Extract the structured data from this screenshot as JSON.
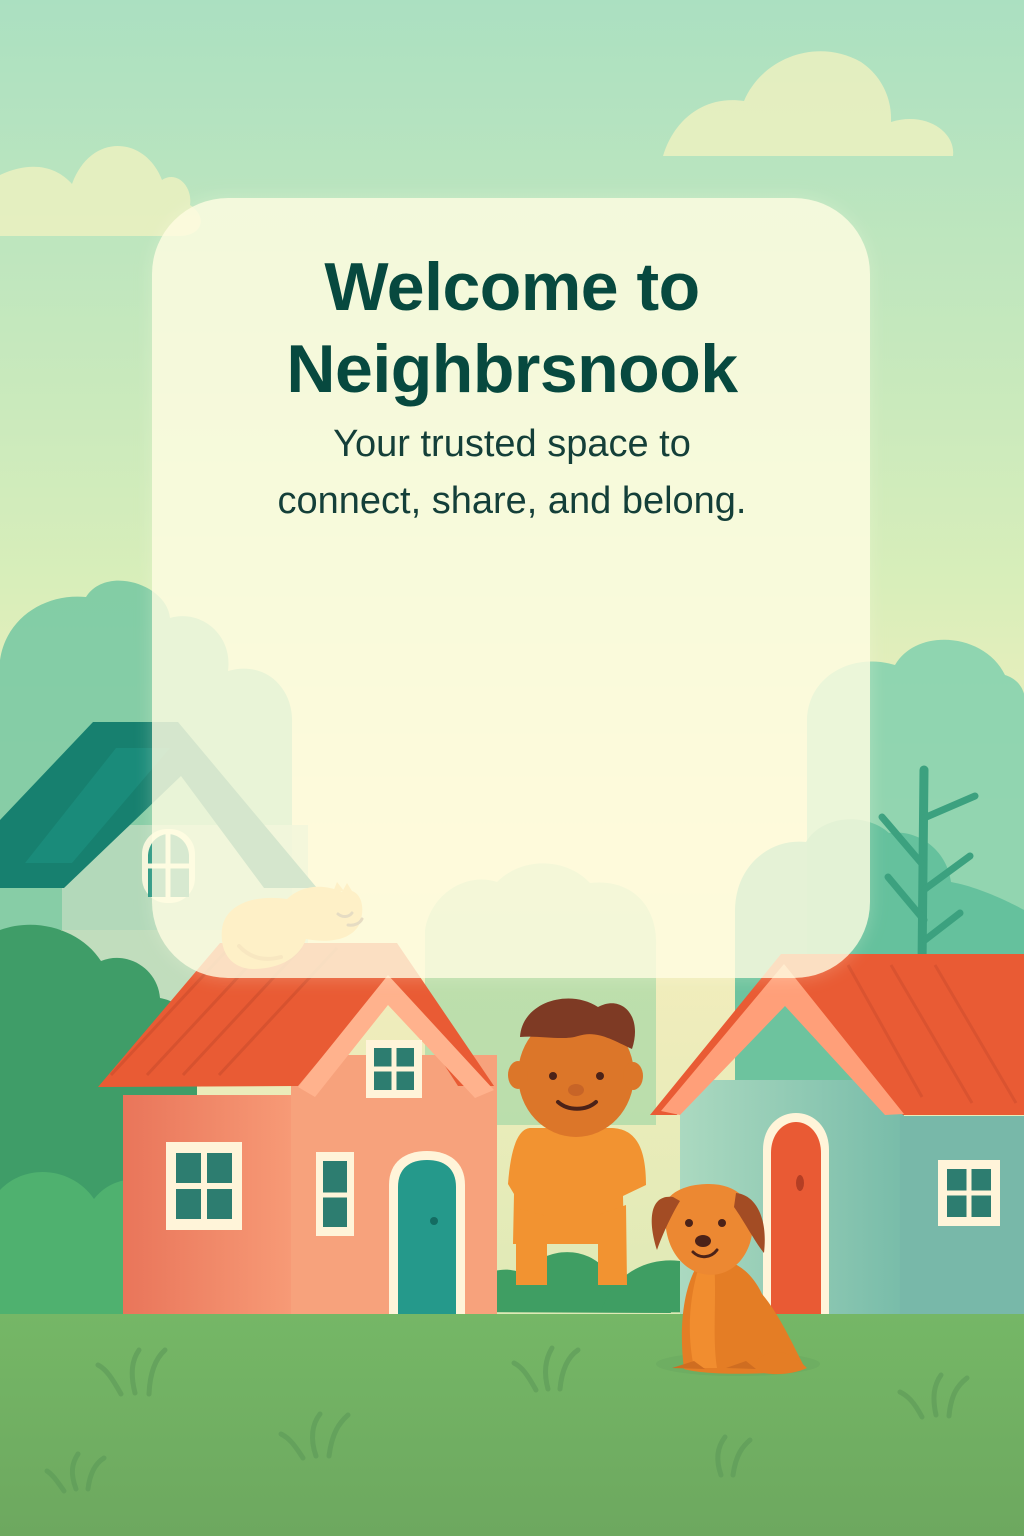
{
  "welcome": {
    "title_line_1": "Welcome to",
    "title_line_2": "Neighbrsnook",
    "subtitle_line_1": "Your trusted space to",
    "subtitle_line_2": "connect, share, and belong."
  },
  "scene": {
    "icons": [
      "cloud-icon",
      "house-icon",
      "tree-icon",
      "cat-icon",
      "person-icon",
      "dog-icon",
      "grass-icon"
    ],
    "colors": {
      "sky_top": "#ace1c1",
      "sky_mid": "#f7efbd",
      "card": "#fffce2",
      "title": "#07493f",
      "roof": "#e65d36",
      "teal_roof": "#17806f",
      "grass": "#6fac61",
      "tree": "#61b992",
      "dog": "#e47d25",
      "cat": "#f6b94e"
    }
  }
}
